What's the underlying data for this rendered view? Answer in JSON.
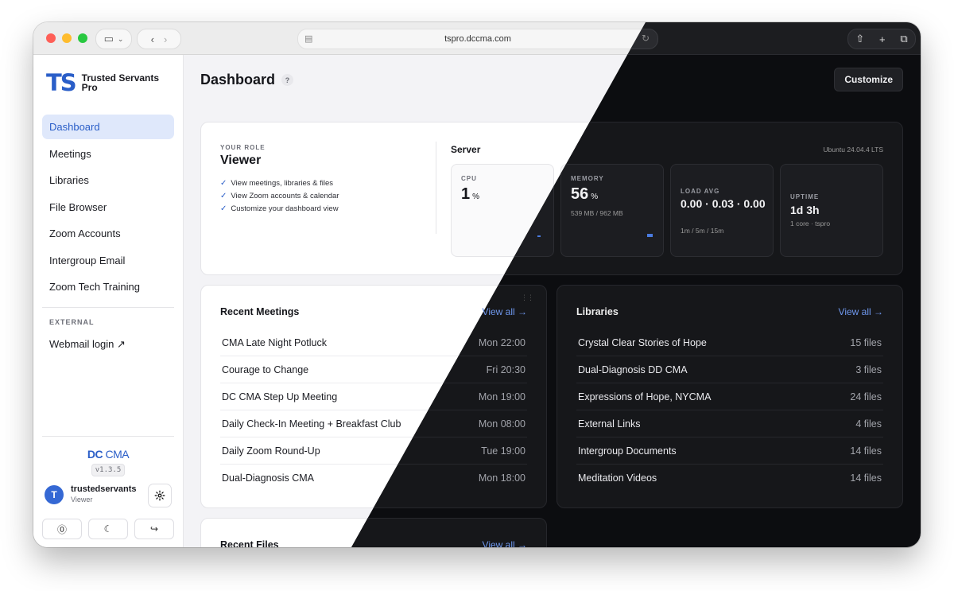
{
  "browser": {
    "url": "tspro.dccma.com"
  },
  "sidebar": {
    "logo_mark": "TS",
    "logo_text": "Trusted Servants Pro",
    "nav": [
      {
        "label": "Dashboard",
        "active": true
      },
      {
        "label": "Meetings"
      },
      {
        "label": "Libraries"
      },
      {
        "label": "File Browser"
      },
      {
        "label": "Zoom Accounts"
      },
      {
        "label": "Intergroup Email"
      },
      {
        "label": "Zoom Tech Training"
      }
    ],
    "external_section": "EXTERNAL",
    "external_link": "Webmail login ↗",
    "org_logo_dc": "DC",
    "org_logo_cma": "CMA",
    "version": "v1.3.5",
    "user": {
      "initial": "T",
      "name": "trustedservants",
      "role": "Viewer"
    }
  },
  "header": {
    "title": "Dashboard",
    "help": "?",
    "customize_label": "Customize"
  },
  "role_card": {
    "label": "YOUR ROLE",
    "role": "Viewer",
    "permissions": [
      "View meetings, libraries & files",
      "View Zoom accounts & calendar",
      "Customize your dashboard view"
    ]
  },
  "server": {
    "title": "Server",
    "os": "Ubuntu 24.04.4 LTS",
    "cpu": {
      "label": "CPU",
      "value": "1",
      "unit": "%"
    },
    "memory": {
      "label": "MEMORY",
      "value": "56",
      "unit": "%",
      "sub": "539 MB / 962 MB"
    },
    "load": {
      "label": "LOAD AVG",
      "value": "0.00 · 0.03 · 0.00",
      "sub": "1m / 5m / 15m"
    },
    "uptime": {
      "label": "UPTIME",
      "value": "1d 3h",
      "sub": "1 core · tspro"
    }
  },
  "recent_meetings": {
    "title": "Recent Meetings",
    "view_all": "View all →",
    "rows": [
      {
        "name": "CMA Late Night Potluck",
        "time": "Mon 22:00"
      },
      {
        "name": "Courage to Change",
        "time": "Fri 20:30"
      },
      {
        "name": "DC CMA Step Up Meeting",
        "time": "Mon 19:00"
      },
      {
        "name": "Daily Check-In Meeting + Breakfast Club",
        "time": "Mon 08:00"
      },
      {
        "name": "Daily Zoom Round-Up",
        "time": "Tue 19:00"
      },
      {
        "name": "Dual-Diagnosis CMA",
        "time": "Mon 18:00"
      }
    ]
  },
  "libraries": {
    "title": "Libraries",
    "view_all": "View all →",
    "rows": [
      {
        "name": "Crystal Clear Stories of Hope",
        "count": "15 files"
      },
      {
        "name": "Dual-Diagnosis DD CMA",
        "count": "3 files"
      },
      {
        "name": "Expressions of Hope, NYCMA",
        "count": "24 files"
      },
      {
        "name": "External Links",
        "count": "4 files"
      },
      {
        "name": "Intergroup Documents",
        "count": "14 files"
      },
      {
        "name": "Meditation Videos",
        "count": "14 files"
      }
    ]
  },
  "recent_files": {
    "title": "Recent Files",
    "view_all": "View all →"
  }
}
